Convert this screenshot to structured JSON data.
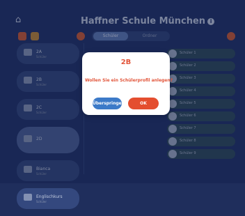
{
  "header": {
    "home_icon": "home-icon",
    "title": "Haffner Schule München",
    "info_icon": "info-icon"
  },
  "tabs": [
    "Schüler",
    "Ordner"
  ],
  "classes": [
    {
      "label": "2A",
      "sub": "Schüler"
    },
    {
      "label": "2B",
      "sub": "Schüler"
    },
    {
      "label": "2C",
      "sub": "Schüler"
    },
    {
      "label": "2D",
      "sub": ""
    },
    {
      "label": "Bianca",
      "sub": "Schüler"
    },
    {
      "label": "Englischkurs",
      "sub": "Schüler"
    }
  ],
  "students": [
    "Schüler 1",
    "Schüler 2",
    "Schüler 3",
    "Schüler 4",
    "Schüler 5",
    "Schüler 6",
    "Schüler 7",
    "Schüler 8",
    "Schüler 9"
  ],
  "dialog": {
    "title": "2B",
    "message": "Wollen Sie ein Schülerprofil anlegen?",
    "skip_label": "Überspringen",
    "ok_label": "OK"
  },
  "colors": {
    "accent": "#e44e2f",
    "secondary": "#3c7ac8",
    "background": "#22346a"
  }
}
